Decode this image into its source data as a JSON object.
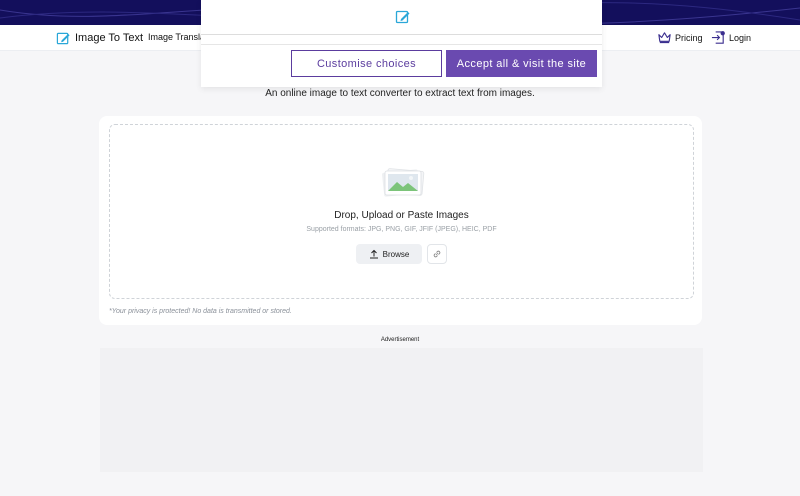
{
  "nav": {
    "logo_text": "Image To Text",
    "link_image_translator": "Image Translat",
    "pricing_label": "Pricing",
    "login_label": "Login"
  },
  "consent": {
    "customise_label": "Customise choices",
    "accept_label": "Accept all & visit the site"
  },
  "main": {
    "subtitle": "An online image to text converter to extract text from images."
  },
  "upload": {
    "title": "Drop, Upload or Paste Images",
    "formats": "Supported formats: JPG, PNG, GIF, JFIF (JPEG), HEIC, PDF",
    "browse_label": "Browse",
    "privacy_note": "*Your privacy is protected! No data is transmitted or stored."
  },
  "ad": {
    "label": "Advertisement"
  },
  "colors": {
    "banner": "#130f5c",
    "accent": "#6a4ab0",
    "accent_outline": "#5b3c9e",
    "page_bg": "#f6f6f8"
  },
  "icons": {
    "logo": "edit-note-icon",
    "pricing": "crown-icon",
    "login": "login-icon",
    "consent": "edit-note-icon",
    "upload_image": "image-stack-icon",
    "browse": "upload-arrow-icon",
    "link": "link-icon"
  }
}
